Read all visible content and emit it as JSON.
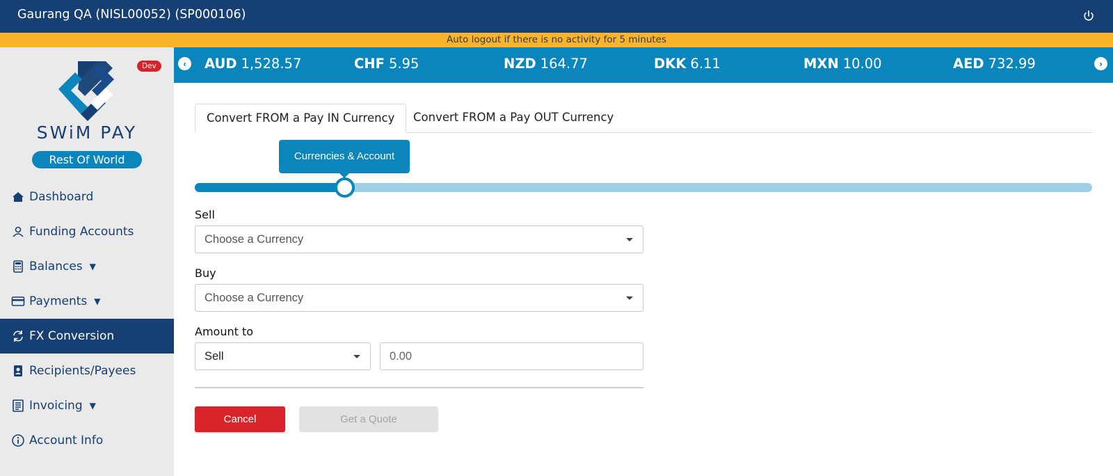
{
  "header": {
    "user_label": "Gaurang QA (NISL00052) (SP000106)",
    "power_icon": "power-icon"
  },
  "notice": {
    "text": "Auto logout if there is no activity for 5 minutes"
  },
  "sidebar": {
    "env_badge": "Dev",
    "brand": "SWiM PAY",
    "region": "Rest Of World",
    "items": [
      {
        "label": "Dashboard",
        "icon": "home-icon",
        "has_caret": false
      },
      {
        "label": "Funding Accounts",
        "icon": "user-icon",
        "has_caret": false
      },
      {
        "label": "Balances",
        "icon": "calculator-icon",
        "has_caret": true
      },
      {
        "label": "Payments",
        "icon": "credit-card-icon",
        "has_caret": true
      },
      {
        "label": "FX Conversion",
        "icon": "sync-icon",
        "has_caret": false,
        "active": true
      },
      {
        "label": "Recipients/Payees",
        "icon": "contact-icon",
        "has_caret": false
      },
      {
        "label": "Invoicing",
        "icon": "invoice-icon",
        "has_caret": true
      },
      {
        "label": "Account Info",
        "icon": "info-icon",
        "has_caret": false
      }
    ]
  },
  "ticker": {
    "rates": [
      {
        "code": "AUD",
        "value": "1,528.57"
      },
      {
        "code": "CHF",
        "value": "5.95"
      },
      {
        "code": "NZD",
        "value": "164.77"
      },
      {
        "code": "DKK",
        "value": "6.11"
      },
      {
        "code": "MXN",
        "value": "10.00"
      },
      {
        "code": "AED",
        "value": "732.99"
      }
    ]
  },
  "tabs": [
    {
      "label": "Convert FROM a Pay IN Currency",
      "active": true
    },
    {
      "label": "Convert FROM a Pay OUT Currency",
      "active": false
    }
  ],
  "stepper": {
    "current_step_label": "Currencies & Account",
    "progress_fraction": 0.167
  },
  "form": {
    "sell_label": "Sell",
    "sell_placeholder": "Choose a Currency",
    "buy_label": "Buy",
    "buy_placeholder": "Choose a Currency",
    "amount_label": "Amount to",
    "amount_mode": "Sell",
    "amount_value": "0.00"
  },
  "actions": {
    "cancel_label": "Cancel",
    "quote_label": "Get a Quote"
  },
  "colors": {
    "navy": "#163f74",
    "accent": "#0a86bd",
    "notice": "#f9b42d",
    "danger": "#d8232a"
  }
}
